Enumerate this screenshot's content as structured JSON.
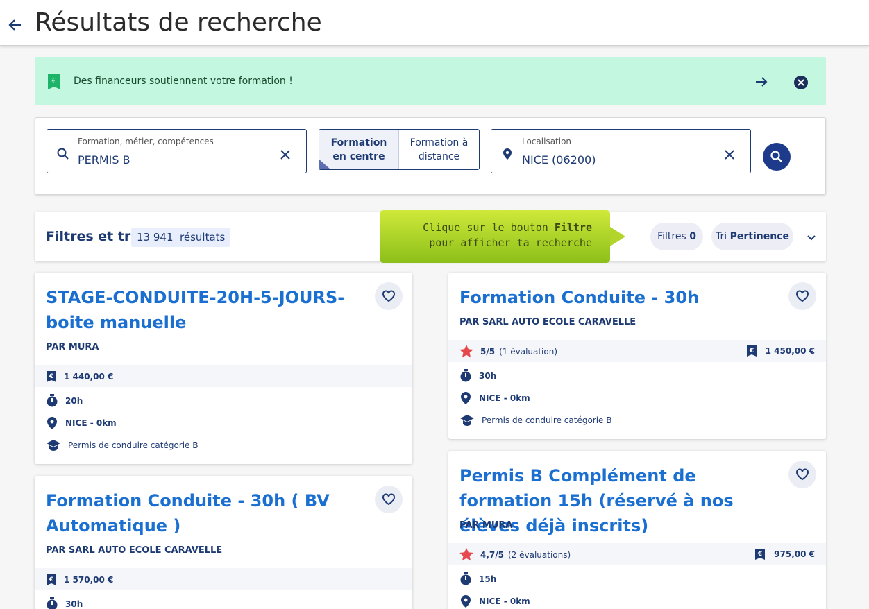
{
  "header": {
    "title": "Résultats de recherche"
  },
  "banner": {
    "text": "Des financeurs soutiennent votre formation !"
  },
  "search": {
    "what_label": "Formation, métier, compétences",
    "what_value": "PERMIS B",
    "mode_onsite_line1": "Formation",
    "mode_onsite_line2": "en centre",
    "mode_remote_line1": "Formation à",
    "mode_remote_line2": "distance",
    "where_label": "Localisation",
    "where_value": "NICE (06200)"
  },
  "filters": {
    "title": "Filtres et tri",
    "results_count": "13 941",
    "results_label": "résultats",
    "filters_label": "Filtres",
    "filters_count": "0",
    "sort_label": "Tri",
    "sort_value": "Pertinence",
    "tooltip_line1_prefix": "Clique sur le bouton ",
    "tooltip_line1_bold": "Filtre",
    "tooltip_line2": "pour afficher ta recherche"
  },
  "cards": [
    {
      "title": "STAGE-CONDUITE-20H-5-JOURS-boite manuelle",
      "org": "PAR MURA",
      "price": "1 440,00 €",
      "duration": "20h",
      "location": "NICE - 0km",
      "certification": "Permis de conduire catégorie B"
    },
    {
      "title": "Formation Conduite - 30h",
      "org": "PAR SARL AUTO ECOLE CARAVELLE",
      "rating": "5/5",
      "reviews": "(1 évaluation)",
      "price": "1 450,00 €",
      "duration": "30h",
      "location": "NICE - 0km",
      "certification": "Permis de conduire catégorie B"
    },
    {
      "title": "Formation Conduite - 30h ( BV Automatique )",
      "org": "PAR SARL AUTO ECOLE CARAVELLE",
      "price": "1 570,00 €",
      "duration": "30h"
    },
    {
      "title": "Permis B Complément de formation 15h (réservé à nos élèves déjà inscrits)",
      "org": "PAR MURA",
      "rating": "4,7/5",
      "reviews": "(2 évaluations)",
      "price": "975,00 €",
      "duration": "15h",
      "location": "NICE - 0km"
    }
  ],
  "colors": {
    "accent": "#1a6fd0",
    "navy": "#1e3a73",
    "banner_bg": "#c3f7df",
    "star": "#e5484d"
  },
  "icons": [
    "back-arrow-icon",
    "euro-badge-icon",
    "arrow-right-icon",
    "close-circle-icon",
    "search-icon",
    "clear-icon",
    "location-pin-icon",
    "heart-icon",
    "star-icon",
    "price-tag-icon",
    "stopwatch-icon",
    "graduation-cap-icon",
    "chevron-down-icon"
  ]
}
